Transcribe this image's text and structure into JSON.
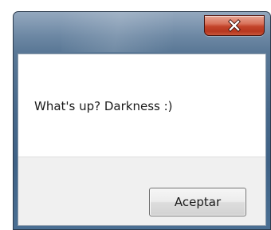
{
  "dialog": {
    "title": "",
    "message": "What's up? Darkness :)",
    "close_icon": "close-x-icon",
    "ok_label": "Aceptar"
  },
  "colors": {
    "frame": "#48698b",
    "close_button": "#c2442b",
    "content_background": "#ffffff",
    "button_panel": "#f0f0f0"
  }
}
